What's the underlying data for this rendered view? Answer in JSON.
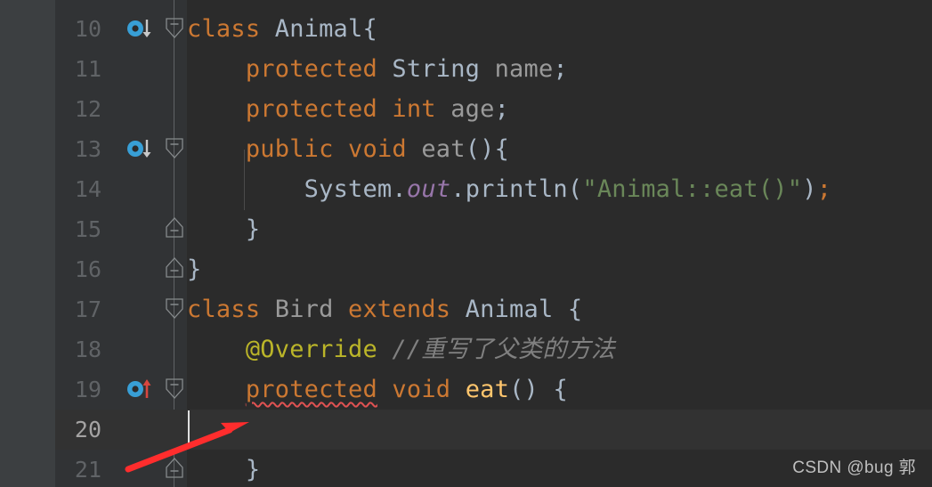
{
  "app": {
    "kind": "code-editor",
    "theme": "darcula",
    "background": "#2B2B2B",
    "gutter_background": "#313335",
    "current_line_background": "#323232",
    "tool_strip_background": "#3C3F41"
  },
  "colors": {
    "keyword": "#CC7832",
    "string": "#6A8759",
    "comment": "#808080",
    "annotation": "#BBB529",
    "method_declaration": "#FFC66D",
    "static_field": "#9876AA",
    "identifier": "#9A9A9A",
    "default_text": "#A9B7C6",
    "line_number": "#606366",
    "line_number_active": "#A4A3A3",
    "error_underline": "#E05252",
    "annotation_arrow": "#FF2D2D",
    "override_marker": "#389FD6",
    "watermark": "#BFBFBF"
  },
  "editor": {
    "first_visible_line": 10,
    "current_line": 20,
    "caret_line": 20,
    "caret_column": 1,
    "lines": [
      {
        "number": "10",
        "indent": 0,
        "gutter_icon": "overridden-method-down-icon",
        "fold": "start",
        "tokens": [
          {
            "text": "class ",
            "style": "kw"
          },
          {
            "text": "Animal",
            "style": "cls"
          },
          {
            "text": "{",
            "style": "punc"
          }
        ]
      },
      {
        "number": "11",
        "indent": 1,
        "gutter_icon": null,
        "fold": null,
        "tokens": [
          {
            "text": "    ",
            "style": "punc"
          },
          {
            "text": "protected ",
            "style": "kw"
          },
          {
            "text": "String ",
            "style": "cls"
          },
          {
            "text": "name",
            "style": "id"
          },
          {
            "text": ";",
            "style": "punc"
          }
        ]
      },
      {
        "number": "12",
        "indent": 1,
        "gutter_icon": null,
        "fold": null,
        "tokens": [
          {
            "text": "    ",
            "style": "punc"
          },
          {
            "text": "protected ",
            "style": "kw"
          },
          {
            "text": "int ",
            "style": "kw"
          },
          {
            "text": "age",
            "style": "id"
          },
          {
            "text": ";",
            "style": "punc"
          }
        ]
      },
      {
        "number": "13",
        "indent": 1,
        "gutter_icon": "overridden-method-down-icon",
        "fold": "start",
        "tokens": [
          {
            "text": "    ",
            "style": "punc"
          },
          {
            "text": "public ",
            "style": "kw"
          },
          {
            "text": "void ",
            "style": "kw"
          },
          {
            "text": "eat",
            "style": "id"
          },
          {
            "text": "(){",
            "style": "punc"
          }
        ]
      },
      {
        "number": "14",
        "indent": 2,
        "gutter_icon": null,
        "fold": null,
        "tokens": [
          {
            "text": "        ",
            "style": "punc"
          },
          {
            "text": "System",
            "style": "cls"
          },
          {
            "text": ".",
            "style": "punc"
          },
          {
            "text": "out",
            "style": "fld"
          },
          {
            "text": ".",
            "style": "punc"
          },
          {
            "text": "println",
            "style": "punc"
          },
          {
            "text": "(",
            "style": "punc"
          },
          {
            "text": "\"Animal::eat()\"",
            "style": "str"
          },
          {
            "text": ")",
            "style": "punc"
          },
          {
            "text": ";",
            "style": "sem"
          }
        ]
      },
      {
        "number": "15",
        "indent": 1,
        "gutter_icon": null,
        "fold": "end",
        "tokens": [
          {
            "text": "    ",
            "style": "punc"
          },
          {
            "text": "}",
            "style": "punc"
          }
        ]
      },
      {
        "number": "16",
        "indent": 0,
        "gutter_icon": null,
        "fold": "end",
        "tokens": [
          {
            "text": "}",
            "style": "punc"
          }
        ]
      },
      {
        "number": "17",
        "indent": 0,
        "gutter_icon": null,
        "fold": "start",
        "tokens": [
          {
            "text": "class ",
            "style": "kw"
          },
          {
            "text": "Bird ",
            "style": "id"
          },
          {
            "text": "extends ",
            "style": "kw"
          },
          {
            "text": "Animal ",
            "style": "cls"
          },
          {
            "text": "{",
            "style": "punc"
          }
        ]
      },
      {
        "number": "18",
        "indent": 1,
        "gutter_icon": null,
        "fold": null,
        "tokens": [
          {
            "text": "    ",
            "style": "punc"
          },
          {
            "text": "@Override ",
            "style": "ann"
          },
          {
            "text": "//重写了父类的方法",
            "style": "cmt"
          }
        ]
      },
      {
        "number": "19",
        "indent": 1,
        "gutter_icon": "overriding-method-up-icon",
        "fold": "start",
        "error_underline": true,
        "tokens": [
          {
            "text": "    ",
            "style": "punc"
          },
          {
            "text": "protected",
            "style": "kw-err"
          },
          {
            "text": " ",
            "style": "punc"
          },
          {
            "text": "void ",
            "style": "kw"
          },
          {
            "text": "eat",
            "style": "meth"
          },
          {
            "text": "()",
            "style": "punc"
          },
          {
            "text": " {",
            "style": "punc"
          }
        ]
      },
      {
        "number": "20",
        "indent": 1,
        "gutter_icon": null,
        "fold": null,
        "tokens": []
      },
      {
        "number": "21",
        "indent": 1,
        "gutter_icon": null,
        "fold": "end",
        "tokens": [
          {
            "text": "    ",
            "style": "punc"
          },
          {
            "text": "}",
            "style": "punc"
          }
        ]
      }
    ]
  },
  "annotation": {
    "arrow_label": "red-annotation-arrow",
    "points_to": "caret at line 20"
  },
  "watermark": {
    "text": "CSDN @bug 郭"
  }
}
